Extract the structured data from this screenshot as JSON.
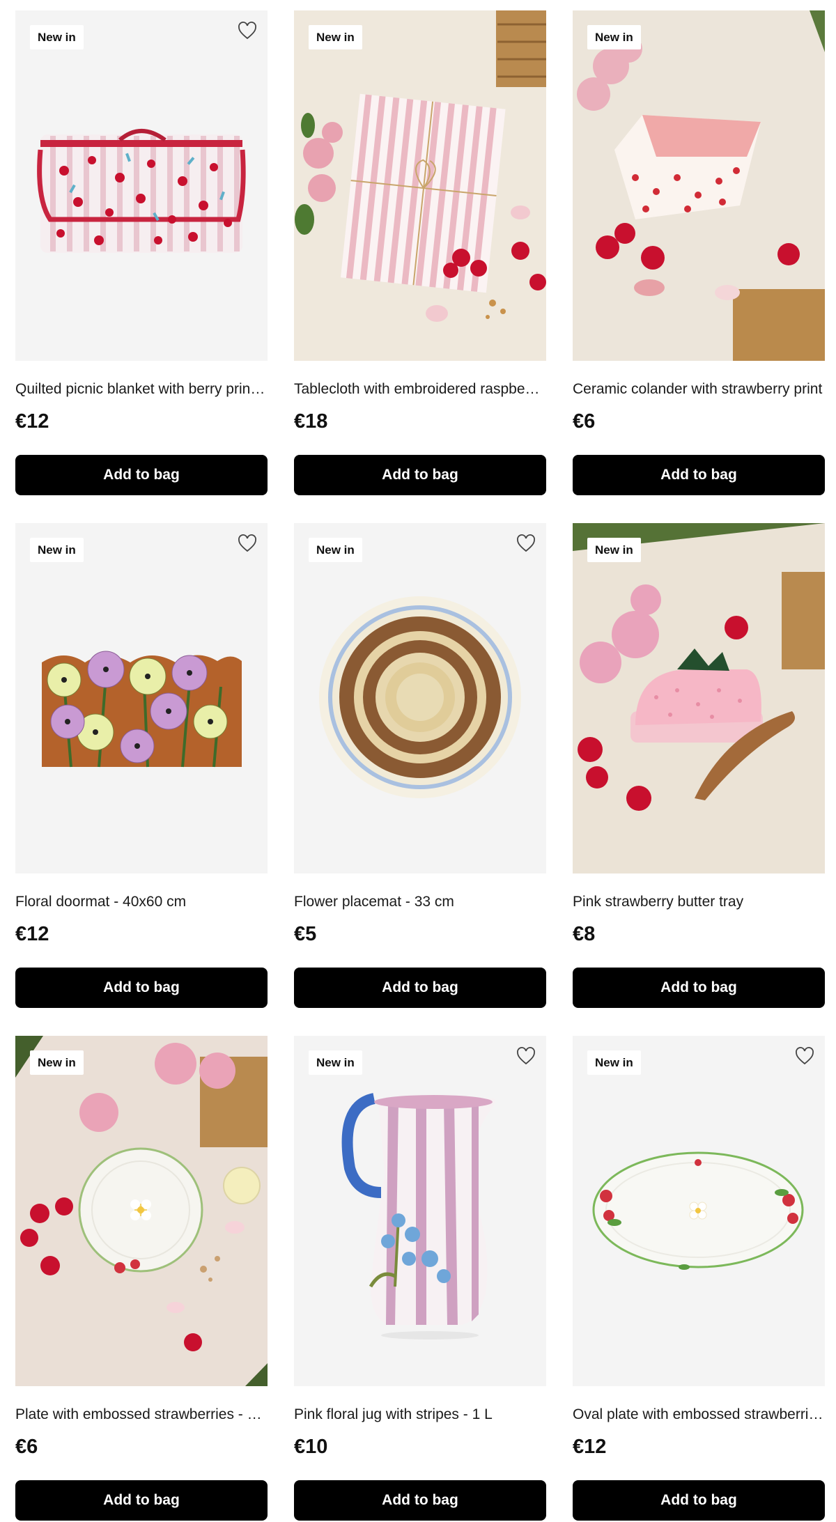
{
  "colors": {
    "button_bg": "#000000",
    "button_text": "#ffffff",
    "badge_bg": "#ffffff",
    "tile_bg": "#f4f4f4"
  },
  "products": [
    {
      "badge": "New in",
      "name": "Quilted picnic blanket with berry prin…",
      "price": "€12",
      "add_label": "Add to bag",
      "image": "picnic-blanket-image",
      "wishlist_icon": "heart-icon"
    },
    {
      "badge": "New in",
      "name": "Tablecloth with embroidered raspbe…",
      "price": "€18",
      "add_label": "Add to bag",
      "image": "tablecloth-image",
      "wishlist_icon": "heart-icon"
    },
    {
      "badge": "New in",
      "name": "Ceramic colander with strawberry print",
      "price": "€6",
      "add_label": "Add to bag",
      "image": "colander-image",
      "wishlist_icon": "heart-icon"
    },
    {
      "badge": "New in",
      "name": "Floral doormat - 40x60 cm",
      "price": "€12",
      "add_label": "Add to bag",
      "image": "doormat-image",
      "wishlist_icon": "heart-icon"
    },
    {
      "badge": "New in",
      "name": "Flower placemat - 33 cm",
      "price": "€5",
      "add_label": "Add to bag",
      "image": "placemat-image",
      "wishlist_icon": "heart-icon"
    },
    {
      "badge": "New in",
      "name": "Pink strawberry butter tray",
      "price": "€8",
      "add_label": "Add to bag",
      "image": "butter-tray-image",
      "wishlist_icon": "heart-icon"
    },
    {
      "badge": "New in",
      "name": "Plate with embossed strawberries - 2…",
      "price": "€6",
      "add_label": "Add to bag",
      "image": "plate-image",
      "wishlist_icon": "heart-icon"
    },
    {
      "badge": "New in",
      "name": "Pink floral jug with stripes - 1 L",
      "price": "€10",
      "add_label": "Add to bag",
      "image": "jug-image",
      "wishlist_icon": "heart-icon"
    },
    {
      "badge": "New in",
      "name": "Oval plate with embossed strawberri…",
      "price": "€12",
      "add_label": "Add to bag",
      "image": "oval-plate-image",
      "wishlist_icon": "heart-icon"
    }
  ]
}
